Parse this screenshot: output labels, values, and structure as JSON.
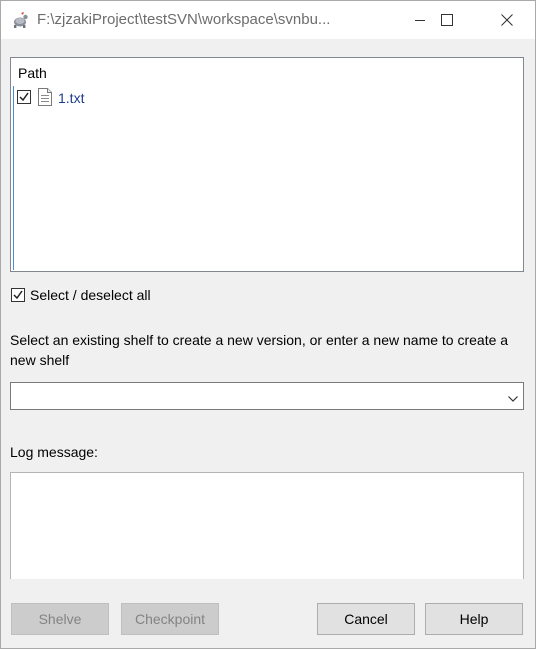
{
  "window": {
    "title": "F:\\zjzakiProject\\testSVN\\workspace\\svnbu..."
  },
  "file_list": {
    "column_header": "Path",
    "items": [
      {
        "name": "1.txt",
        "checked": true,
        "icon": "text-file-icon"
      }
    ]
  },
  "select_all": {
    "label": "Select / deselect all",
    "checked": true
  },
  "shelf": {
    "instruction": "Select an existing shelf to create a new version, or enter a new name to create a new shelf",
    "value": ""
  },
  "log": {
    "label": "Log message:",
    "value": ""
  },
  "buttons": {
    "shelve": "Shelve",
    "checkpoint": "Checkpoint",
    "cancel": "Cancel",
    "help": "Help"
  }
}
